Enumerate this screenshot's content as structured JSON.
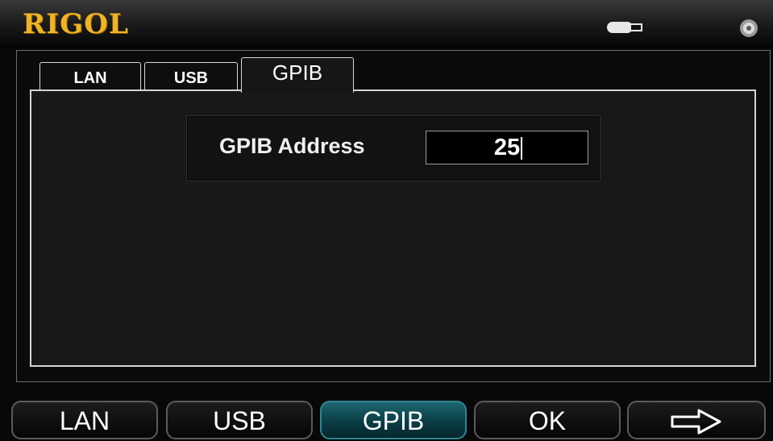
{
  "header": {
    "logo_text": "RIGOL",
    "usb_icon": "usb-device-icon",
    "speaker_icon": "speaker-icon"
  },
  "tabs": [
    {
      "label": "LAN",
      "active": false
    },
    {
      "label": "USB",
      "active": false
    },
    {
      "label": "GPIB",
      "active": true
    }
  ],
  "gpib": {
    "address_label": "GPIB Address",
    "address_value": "25"
  },
  "softkeys": [
    {
      "label": "LAN"
    },
    {
      "label": "USB"
    },
    {
      "label": "GPIB",
      "active": true
    },
    {
      "label": "OK"
    },
    {
      "label": "",
      "icon": "right-arrow-icon"
    }
  ],
  "colors": {
    "logo": "#f0b323",
    "active_softkey": "#0a3d45",
    "background": "#080808"
  }
}
